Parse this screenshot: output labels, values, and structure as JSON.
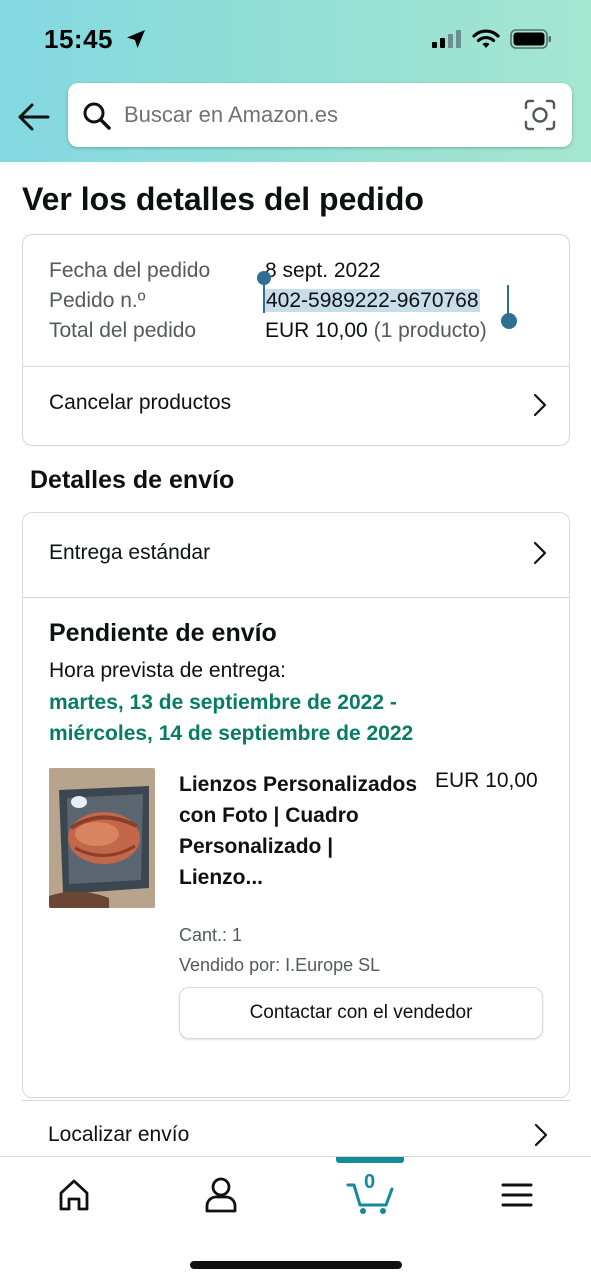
{
  "status_bar": {
    "time": "15:45"
  },
  "search": {
    "placeholder": "Buscar en Amazon.es"
  },
  "page": {
    "title": "Ver los detalles del pedido"
  },
  "order": {
    "date_label": "Fecha del pedido",
    "date_value": "8 sept. 2022",
    "number_label": "Pedido n.º",
    "number_value": "402-5989222-9670768",
    "total_label": "Total del pedido",
    "total_value": "EUR 10,00",
    "total_items": "(1 producto)",
    "cancel_label": "Cancelar productos"
  },
  "shipping": {
    "section_title": "Detalles de envío",
    "method": "Entrega estándar",
    "status": "Pendiente de envío",
    "eta_label": "Hora prevista de entrega:",
    "eta_line1": "martes, 13 de septiembre de 2022 -",
    "eta_line2": "miércoles, 14 de septiembre de 2022"
  },
  "product": {
    "title": "Lienzos Personalizados con Foto | Cuadro Personalizado | Lienzo...",
    "price": "EUR 10,00",
    "qty": "Cant.: 1",
    "seller": "Vendido por: I.Europe SL",
    "contact_label": "Contactar con el vendedor"
  },
  "track": {
    "label": "Localizar envío"
  },
  "nav": {
    "cart_count": "0"
  },
  "colors": {
    "accent": "#138a9c",
    "delivery_green": "#067d62",
    "selection": "#c7dde9"
  },
  "icons": [
    "location-arrow-icon",
    "signal-icon",
    "wifi-icon",
    "battery-icon",
    "back-arrow-icon",
    "search-icon",
    "camera-icon",
    "chevron-right-icon",
    "home-icon",
    "account-icon",
    "cart-icon",
    "menu-icon"
  ]
}
